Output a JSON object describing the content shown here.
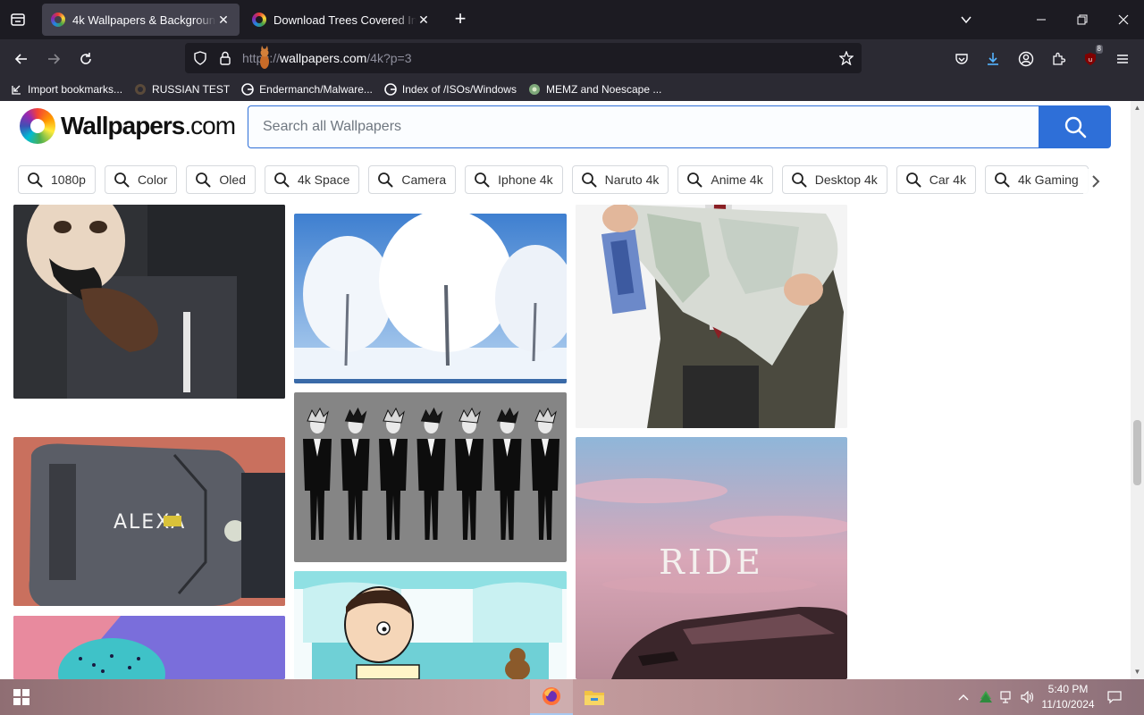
{
  "browser": {
    "tabs": [
      {
        "title": "4k Wallpapers & Backgrounds F",
        "active": true
      },
      {
        "title": "Download Trees Covered In Salt",
        "active": false
      }
    ],
    "url_scheme": "https://",
    "url_host": "wallpapers.com",
    "url_path": "/4k?p=3",
    "downloads_badge": "8"
  },
  "bookmarks": [
    {
      "label": "Import bookmarks...",
      "icon": "import-icon"
    },
    {
      "label": "RUSSIAN TEST",
      "icon": "page-icon"
    },
    {
      "label": "Endermanch/Malware...",
      "icon": "google-icon"
    },
    {
      "label": "Index of /ISOs/Windows",
      "icon": "google-icon"
    },
    {
      "label": "MEMZ and Noescape ...",
      "icon": "site-icon"
    }
  ],
  "site": {
    "logo_bold": "Wallpapers",
    "logo_thin": ".com",
    "search_placeholder": "Search all Wallpapers",
    "chips": [
      "1080p",
      "Color",
      "Oled",
      "4k Space",
      "Camera",
      "Iphone 4k",
      "Naruto 4k",
      "Anime 4k",
      "Desktop 4k",
      "Car 4k",
      "4k Gaming"
    ]
  },
  "tiles": {
    "ride_caption": "RIDE",
    "alexa_text": "ALEXA"
  },
  "taskbar": {
    "time": "5:40 PM",
    "date": "11/10/2024"
  },
  "colors": {
    "browser_dark": "#1c1b22",
    "toolbar": "#2b2a33",
    "accent_blue": "#2e6fd8"
  }
}
